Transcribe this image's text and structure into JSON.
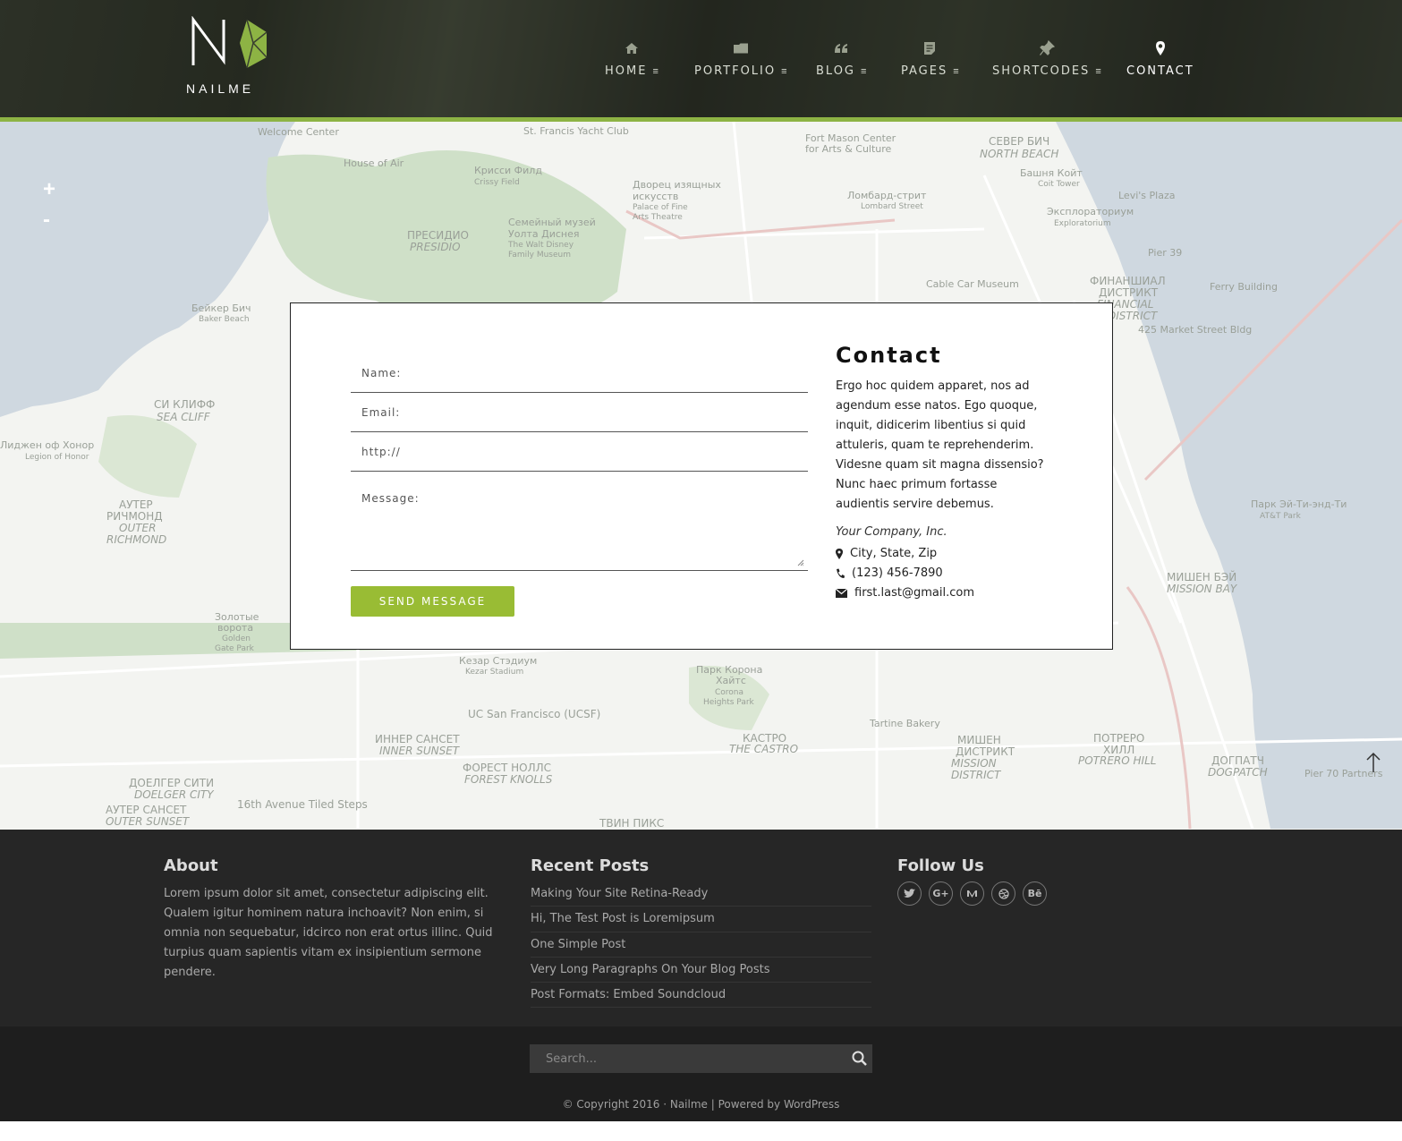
{
  "brand": {
    "name": "NAILME"
  },
  "nav": {
    "items": [
      {
        "label": "HOME",
        "icon": "home-icon",
        "has_submenu": true
      },
      {
        "label": "PORTFOLIO",
        "icon": "folder-icon",
        "has_submenu": true
      },
      {
        "label": "BLOG",
        "icon": "quote-icon",
        "has_submenu": true
      },
      {
        "label": "PAGES",
        "icon": "document-icon",
        "has_submenu": true
      },
      {
        "label": "SHORTCODES",
        "icon": "pushpin-icon",
        "has_submenu": true
      },
      {
        "label": "CONTACT",
        "icon": "map-marker-icon",
        "has_submenu": false,
        "active": true
      }
    ]
  },
  "map": {
    "zoom_in": "+",
    "zoom_out": "-",
    "labels": [
      "Welcome Center",
      "St. Francis Yacht Club",
      "House of Air",
      "Крисси Филд",
      "Crissy Field",
      "Дворец изящных",
      "искусств",
      "Palace of Fine",
      "Arts Theatre",
      "Fort Mason Center",
      "for Arts & Culture",
      "СЕВЕР БИЧ",
      "NORTH BEACH",
      "Башня Койт",
      "Coit Tower",
      "Levi's Plaza",
      "Ломбард-стрит",
      "Lombard Street",
      "Эксплораториум",
      "Exploratorium",
      "Семейный музей",
      "Уолта Диснея",
      "The Walt Disney",
      "Family Museum",
      "ПРЕСИДИО",
      "PRESIDIO",
      "Cable Car Museum",
      "ФИНАНШИАЛ",
      "ДИСТРИКТ",
      "FINANCIAL",
      "DISTRICT",
      "Ferry Building",
      "425 Market Street Bldg",
      "Бейкер Бич",
      "Baker Beach",
      "СИ КЛИФФ",
      "SEA CLIFF",
      "Лиджен оф Хонор",
      "Legion of Honor",
      "АУТЕР",
      "РИЧМОНД",
      "OUTER",
      "RICHMOND",
      "Парк Эй-Ти-энд-Ти",
      "AT&T Park",
      "МИШЕН БЭЙ",
      "MISSION BAY",
      "Золотые",
      "ворота",
      "Golden",
      "Gate Park",
      "Кезар Стэдиум",
      "Kezar Stadium",
      "Парк Корона",
      "Хайтс",
      "Corona",
      "Heights Park",
      "UC San Francisco (UCSF)",
      "Tartine Bakery",
      "ИННЕР САНСЕТ",
      "INNER SUNSET",
      "КАСТРО",
      "THE CASTRO",
      "МИШЕН",
      "ДИСТРИКТ",
      "MISSION",
      "DISTRICT",
      "ПОТРЕРО",
      "ХИЛЛ",
      "POTRERO HILL",
      "ДОГПАТЧ",
      "DOGPATCH",
      "Pier 70 Partners",
      "ДОЕЛГЕР СИТИ",
      "DOELGER CITY",
      "ФОРЕСТ НОЛЛС",
      "FOREST KNOLLS",
      "АУТЕР САНСЕТ",
      "OUTER SUNSET",
      "16th Avenue Tiled Steps",
      "ТВИН ПИКС",
      "Pier 39"
    ]
  },
  "contact_form": {
    "name_placeholder": "Name:",
    "email_placeholder": "Email:",
    "url_placeholder": "http://",
    "message_placeholder": "Message:",
    "submit_label": "SEND MESSAGE"
  },
  "contact_info": {
    "title": "Contact",
    "body": "Ergo hoc quidem apparet, nos ad agendum esse natos. Ego quoque, inquit, didicerim libentius si quid attuleris, quam te reprehenderim. Videsne quam sit magna dissensio? Nunc haec primum fortasse audientis servire debemus.",
    "company": "Your Company, Inc.",
    "address": "City, State, Zip",
    "phone": "(123) 456-7890",
    "email": "first.last@gmail.com"
  },
  "footer": {
    "about": {
      "title": "About",
      "text": "Lorem ipsum dolor sit amet, consectetur adipiscing elit. Qualem igitur hominem natura inchoavit? Non enim, si omnia non sequebatur, idcirco non erat ortus illinc. Quid turpius quam sapientis vitam ex insipientium sermone pendere."
    },
    "recent_posts": {
      "title": "Recent Posts",
      "items": [
        "Making Your Site Retina-Ready",
        "Hi, The Test Post is Loremipsum",
        "One Simple Post",
        "Very Long Paragraphs On Your Blog Posts",
        "Post Formats: Embed Soundcloud"
      ]
    },
    "follow": {
      "title": "Follow Us",
      "networks": [
        "twitter-icon",
        "google-plus-icon",
        "medium-icon",
        "dribbble-icon",
        "behance-icon"
      ],
      "behance_label": "Bē",
      "gplus_label": "G+"
    }
  },
  "bottom": {
    "search_placeholder": "Search...",
    "copyright_prefix": "© Copyright 2016 · ",
    "copyright_site": "Nailme",
    "copyright_sep": " | Powered by ",
    "copyright_platform": "WordPress"
  },
  "colors": {
    "accent": "#99bc34",
    "header_stripe": "#8db344",
    "footer_bg": "#262626",
    "bottom_bg": "#1e1e1e"
  }
}
